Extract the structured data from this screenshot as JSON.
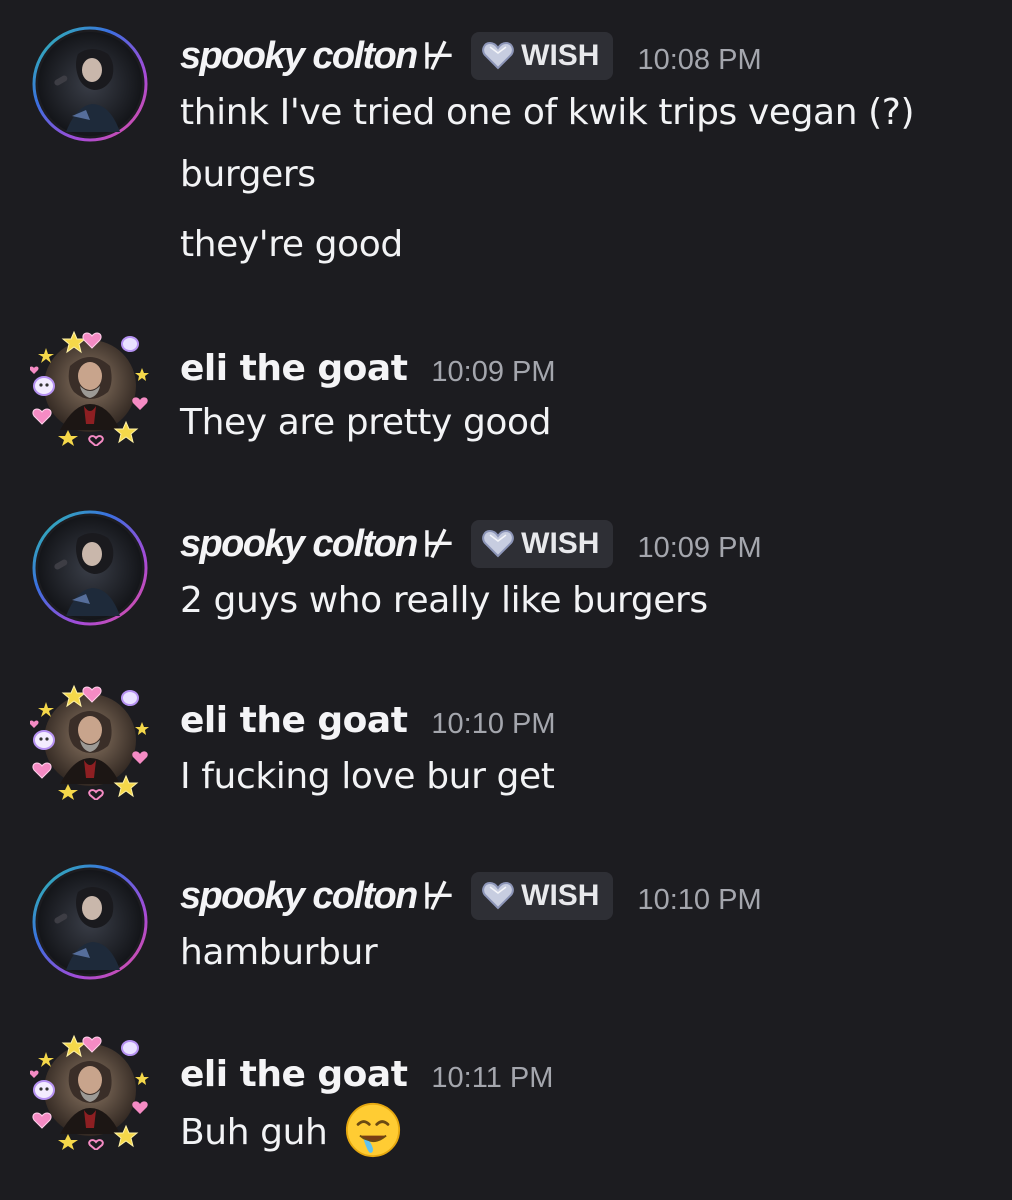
{
  "colors": {
    "background": "#1c1c20",
    "text": "#f2f3f5",
    "timestamp": "#a4a6ad",
    "tag_bg": "#2e2f35"
  },
  "messages": [
    {
      "author": "spooky colton",
      "pronoun_glyph": "⊬",
      "tag": "WISH",
      "tag_icon": "heart-gem-icon",
      "time": "10:08 PM",
      "lines": [
        "think I've tried one of kwik trips vegan (?)",
        "burgers",
        "they're good"
      ]
    },
    {
      "author": "eli the goat",
      "time": "10:09 PM",
      "lines": [
        "They are pretty good"
      ]
    },
    {
      "author": "spooky colton",
      "pronoun_glyph": "⊬",
      "tag": "WISH",
      "tag_icon": "heart-gem-icon",
      "time": "10:09 PM",
      "lines": [
        "2 guys who really like burgers"
      ]
    },
    {
      "author": "eli the goat",
      "time": "10:10 PM",
      "lines": [
        "I fucking love bur get"
      ]
    },
    {
      "author": "spooky colton",
      "pronoun_glyph": "⊬",
      "tag": "WISH",
      "tag_icon": "heart-gem-icon",
      "time": "10:10 PM",
      "lines": [
        "hamburbur"
      ]
    },
    {
      "author": "eli the goat",
      "time": "10:11 PM",
      "lines": [
        "Buh guh"
      ],
      "emoji": "drooling-face-emoji"
    }
  ]
}
